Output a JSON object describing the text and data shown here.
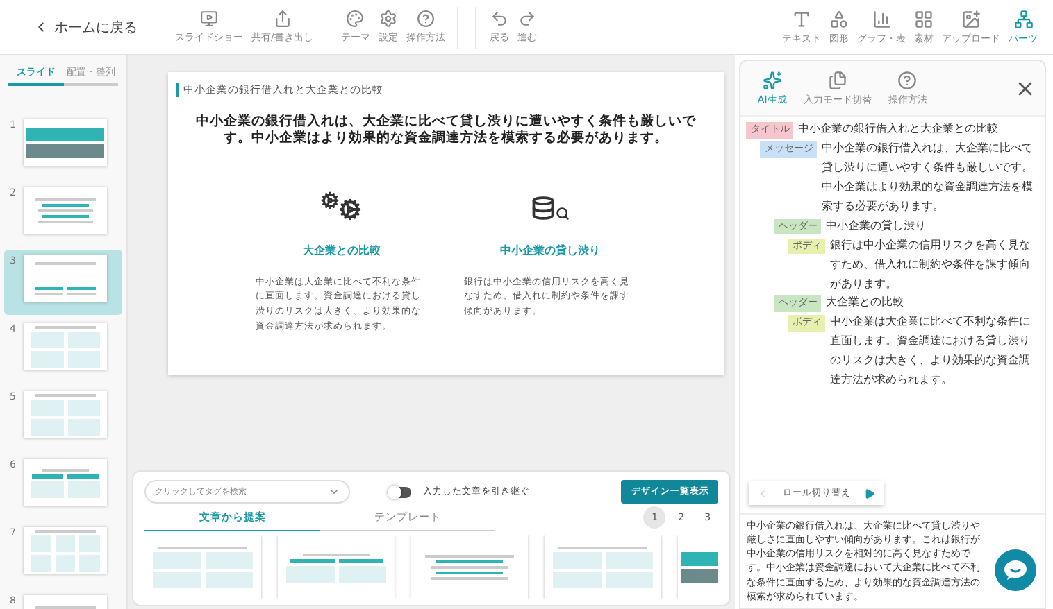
{
  "toolbar": {
    "back": "ホームに戻る",
    "left_tools": [
      {
        "kind": "slideshow",
        "label": "スライドショー"
      },
      {
        "kind": "share",
        "label": "共有/書き出し"
      },
      {
        "kind": "theme",
        "label": "テーマ"
      },
      {
        "kind": "settings",
        "label": "設定"
      },
      {
        "kind": "help",
        "label": "操作方法"
      },
      {
        "kind": "undo",
        "label": "戻る"
      },
      {
        "kind": "redo",
        "label": "進む"
      }
    ],
    "right_tools": [
      {
        "kind": "text",
        "label": "テキスト",
        "selected": false
      },
      {
        "kind": "shape",
        "label": "図形",
        "selected": false
      },
      {
        "kind": "chart",
        "label": "グラフ・表",
        "selected": false
      },
      {
        "kind": "material",
        "label": "素材",
        "selected": false
      },
      {
        "kind": "upload",
        "label": "アップロード",
        "selected": false
      },
      {
        "kind": "parts",
        "label": "パーツ",
        "selected": true
      }
    ]
  },
  "sidebar": {
    "tabs": [
      {
        "label": "スライド",
        "selected": true
      },
      {
        "label": "配置・整列",
        "selected": false
      }
    ],
    "slides": [
      {
        "number": "1",
        "kind": "cover",
        "selected": false
      },
      {
        "number": "2",
        "kind": "list",
        "selected": false
      },
      {
        "number": "3",
        "kind": "icons",
        "selected": true
      },
      {
        "number": "4",
        "kind": "cards",
        "selected": false
      },
      {
        "number": "5",
        "kind": "cards",
        "selected": false
      },
      {
        "number": "6",
        "kind": "columns",
        "selected": false
      },
      {
        "number": "7",
        "kind": "three",
        "selected": false
      },
      {
        "number": "8",
        "kind": "list",
        "selected": false
      }
    ]
  },
  "slide": {
    "title": "中小企業の銀行借入れと大企業との比較",
    "message": "中小企業の銀行借入れは、大企業に比べて貸し渋りに遭いやすく条件も厳しいです。中小企業はより効果的な資金調達方法を模索する必要があります。",
    "columns": [
      {
        "kind": "gears",
        "heading": "大企業との比較",
        "body": "中小企業は大企業に比べて不利な条件に直面します。資金調達における貸し渋りのリスクは大きく、より効果的な資金調達方法が求められます。"
      },
      {
        "kind": "database",
        "heading": "中小企業の貸し渋り",
        "body": "銀行は中小企業の信用リスクを高く見なすため、借入れに制約や条件を課す傾向があります。"
      }
    ]
  },
  "design_panel": {
    "tag_search": {
      "placeholder": "クリックしてタグを検索"
    },
    "carry_over": {
      "on": false,
      "label": "入力した文章を引き継ぐ"
    },
    "show_designs_button": "デザイン一覧表示",
    "tabs": [
      {
        "label": "文章から提案",
        "selected": true
      },
      {
        "label": "テンプレート",
        "selected": false
      }
    ],
    "pages": [
      {
        "label": "1",
        "selected": true
      },
      {
        "label": "2",
        "selected": false
      },
      {
        "label": "3",
        "selected": false
      }
    ],
    "designs": [
      {
        "kind": "cards"
      },
      {
        "kind": "columns"
      },
      {
        "kind": "list"
      },
      {
        "kind": "cards"
      },
      {
        "kind": "cover"
      }
    ]
  },
  "text_panel": {
    "tools": [
      {
        "kind": "ai",
        "label": "AI生成",
        "selected": true
      },
      {
        "kind": "mode",
        "label": "入力モード切替",
        "selected": false
      },
      {
        "kind": "help",
        "label": "操作方法",
        "selected": false
      }
    ],
    "outline": [
      {
        "tag": "タイトル",
        "color": "#f7c6cc",
        "text": "中小企業の銀行借入れと大企業との比較",
        "children": [
          {
            "tag": "メッセージ",
            "color": "#c9e1f7",
            "text": "中小企業の銀行借入れは、大企業に比べて貸し渋りに遭いやすく条件も厳しいです。中小企業はより効果的な資金調達方法を模索する必要があります。",
            "children": [
              {
                "tag": "ヘッダー",
                "color": "#c8e6c1",
                "text": "中小企業の貸し渋り",
                "children": [
                  {
                    "tag": "ボディ",
                    "color": "#e8f0b0",
                    "text": "銀行は中小企業の信用リスクを高く見なすため、借入れに制約や条件を課す傾向があります。"
                  }
                ]
              },
              {
                "tag": "ヘッダー",
                "color": "#c8e6c1",
                "text": "大企業との比較",
                "children": [
                  {
                    "tag": "ボディ",
                    "color": "#e8f0b0",
                    "text": "中小企業は大企業に比べて不利な条件に直面します。資金調達における貸し渋りのリスクは大きく、より効果的な資金調達方法が求められます。"
                  }
                ]
              }
            ]
          }
        ]
      }
    ],
    "role_switch": "ロール切り替え",
    "source_text": "中小企業の銀行借入れは、大企業に比べて貸し渋りや厳しさに直面しやすい傾向があります。これは銀行が中小企業の信用リスクを相対的に高く見なすためです。中小企業は資金調達において大企業に比べて不利な条件に直面するため、より効果的な資金調達方法の模索が求められています。"
  }
}
